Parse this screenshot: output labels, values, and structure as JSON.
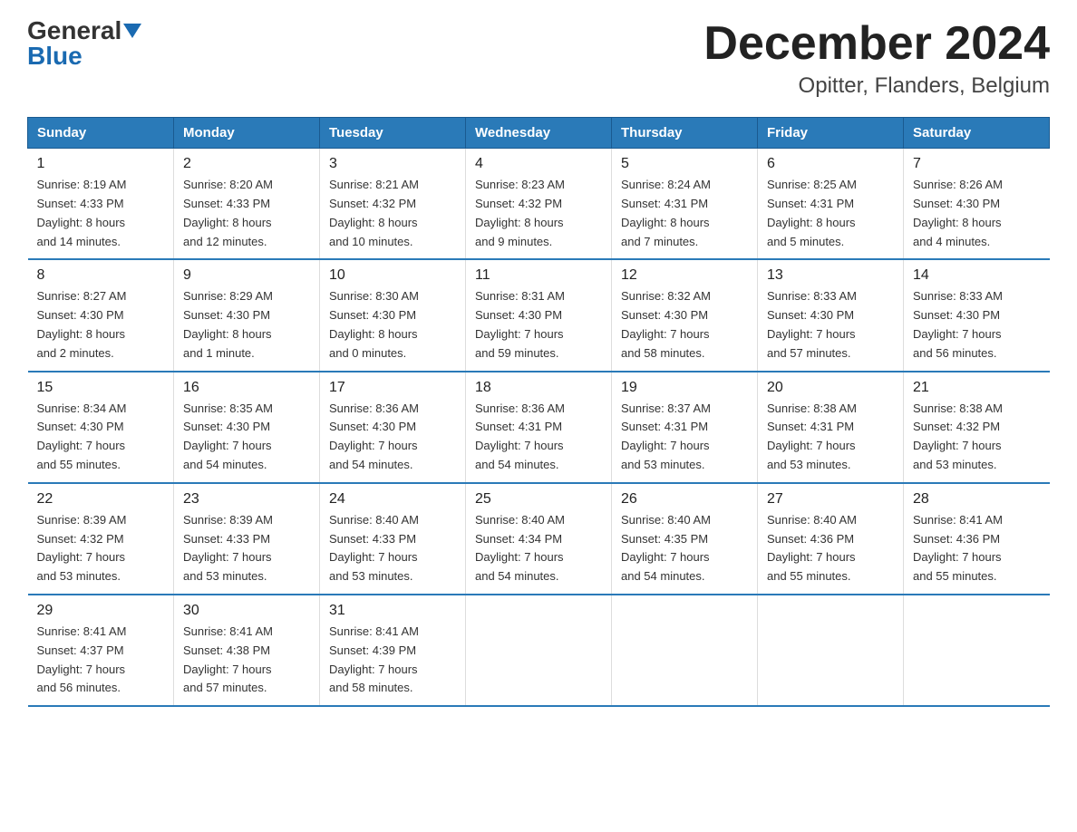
{
  "logo": {
    "general": "General",
    "blue": "Blue"
  },
  "title": "December 2024",
  "location": "Opitter, Flanders, Belgium",
  "days_of_week": [
    "Sunday",
    "Monday",
    "Tuesday",
    "Wednesday",
    "Thursday",
    "Friday",
    "Saturday"
  ],
  "weeks": [
    [
      {
        "num": "1",
        "info": "Sunrise: 8:19 AM\nSunset: 4:33 PM\nDaylight: 8 hours\nand 14 minutes."
      },
      {
        "num": "2",
        "info": "Sunrise: 8:20 AM\nSunset: 4:33 PM\nDaylight: 8 hours\nand 12 minutes."
      },
      {
        "num": "3",
        "info": "Sunrise: 8:21 AM\nSunset: 4:32 PM\nDaylight: 8 hours\nand 10 minutes."
      },
      {
        "num": "4",
        "info": "Sunrise: 8:23 AM\nSunset: 4:32 PM\nDaylight: 8 hours\nand 9 minutes."
      },
      {
        "num": "5",
        "info": "Sunrise: 8:24 AM\nSunset: 4:31 PM\nDaylight: 8 hours\nand 7 minutes."
      },
      {
        "num": "6",
        "info": "Sunrise: 8:25 AM\nSunset: 4:31 PM\nDaylight: 8 hours\nand 5 minutes."
      },
      {
        "num": "7",
        "info": "Sunrise: 8:26 AM\nSunset: 4:30 PM\nDaylight: 8 hours\nand 4 minutes."
      }
    ],
    [
      {
        "num": "8",
        "info": "Sunrise: 8:27 AM\nSunset: 4:30 PM\nDaylight: 8 hours\nand 2 minutes."
      },
      {
        "num": "9",
        "info": "Sunrise: 8:29 AM\nSunset: 4:30 PM\nDaylight: 8 hours\nand 1 minute."
      },
      {
        "num": "10",
        "info": "Sunrise: 8:30 AM\nSunset: 4:30 PM\nDaylight: 8 hours\nand 0 minutes."
      },
      {
        "num": "11",
        "info": "Sunrise: 8:31 AM\nSunset: 4:30 PM\nDaylight: 7 hours\nand 59 minutes."
      },
      {
        "num": "12",
        "info": "Sunrise: 8:32 AM\nSunset: 4:30 PM\nDaylight: 7 hours\nand 58 minutes."
      },
      {
        "num": "13",
        "info": "Sunrise: 8:33 AM\nSunset: 4:30 PM\nDaylight: 7 hours\nand 57 minutes."
      },
      {
        "num": "14",
        "info": "Sunrise: 8:33 AM\nSunset: 4:30 PM\nDaylight: 7 hours\nand 56 minutes."
      }
    ],
    [
      {
        "num": "15",
        "info": "Sunrise: 8:34 AM\nSunset: 4:30 PM\nDaylight: 7 hours\nand 55 minutes."
      },
      {
        "num": "16",
        "info": "Sunrise: 8:35 AM\nSunset: 4:30 PM\nDaylight: 7 hours\nand 54 minutes."
      },
      {
        "num": "17",
        "info": "Sunrise: 8:36 AM\nSunset: 4:30 PM\nDaylight: 7 hours\nand 54 minutes."
      },
      {
        "num": "18",
        "info": "Sunrise: 8:36 AM\nSunset: 4:31 PM\nDaylight: 7 hours\nand 54 minutes."
      },
      {
        "num": "19",
        "info": "Sunrise: 8:37 AM\nSunset: 4:31 PM\nDaylight: 7 hours\nand 53 minutes."
      },
      {
        "num": "20",
        "info": "Sunrise: 8:38 AM\nSunset: 4:31 PM\nDaylight: 7 hours\nand 53 minutes."
      },
      {
        "num": "21",
        "info": "Sunrise: 8:38 AM\nSunset: 4:32 PM\nDaylight: 7 hours\nand 53 minutes."
      }
    ],
    [
      {
        "num": "22",
        "info": "Sunrise: 8:39 AM\nSunset: 4:32 PM\nDaylight: 7 hours\nand 53 minutes."
      },
      {
        "num": "23",
        "info": "Sunrise: 8:39 AM\nSunset: 4:33 PM\nDaylight: 7 hours\nand 53 minutes."
      },
      {
        "num": "24",
        "info": "Sunrise: 8:40 AM\nSunset: 4:33 PM\nDaylight: 7 hours\nand 53 minutes."
      },
      {
        "num": "25",
        "info": "Sunrise: 8:40 AM\nSunset: 4:34 PM\nDaylight: 7 hours\nand 54 minutes."
      },
      {
        "num": "26",
        "info": "Sunrise: 8:40 AM\nSunset: 4:35 PM\nDaylight: 7 hours\nand 54 minutes."
      },
      {
        "num": "27",
        "info": "Sunrise: 8:40 AM\nSunset: 4:36 PM\nDaylight: 7 hours\nand 55 minutes."
      },
      {
        "num": "28",
        "info": "Sunrise: 8:41 AM\nSunset: 4:36 PM\nDaylight: 7 hours\nand 55 minutes."
      }
    ],
    [
      {
        "num": "29",
        "info": "Sunrise: 8:41 AM\nSunset: 4:37 PM\nDaylight: 7 hours\nand 56 minutes."
      },
      {
        "num": "30",
        "info": "Sunrise: 8:41 AM\nSunset: 4:38 PM\nDaylight: 7 hours\nand 57 minutes."
      },
      {
        "num": "31",
        "info": "Sunrise: 8:41 AM\nSunset: 4:39 PM\nDaylight: 7 hours\nand 58 minutes."
      },
      null,
      null,
      null,
      null
    ]
  ]
}
